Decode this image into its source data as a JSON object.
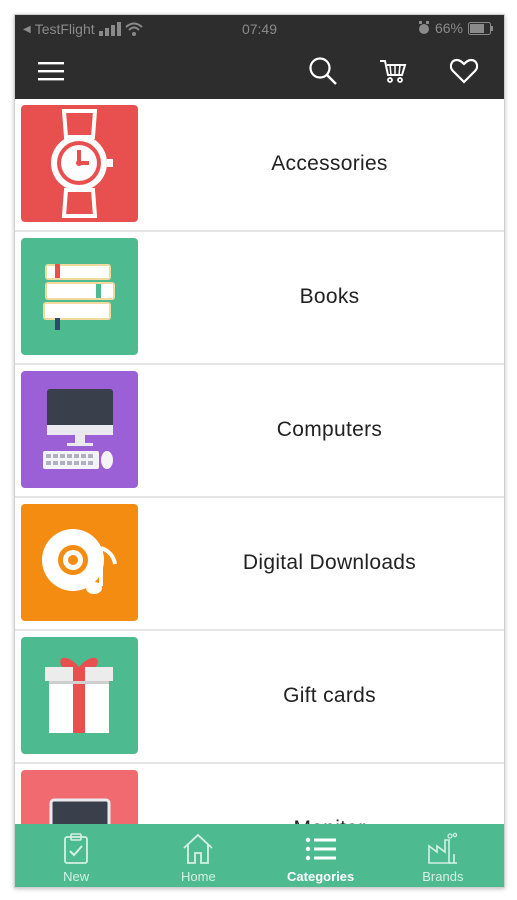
{
  "statusbar": {
    "back_app": "TestFlight",
    "time": "07:49",
    "battery": "66%"
  },
  "toolbar": {
    "icons": [
      "menu-icon",
      "search-icon",
      "cart-icon",
      "heart-icon"
    ]
  },
  "categories": [
    {
      "label": "Accessories",
      "color": "#e8504f",
      "icon": "watch-icon"
    },
    {
      "label": "Books",
      "color": "#4dbb8f",
      "icon": "books-icon"
    },
    {
      "label": "Computers",
      "color": "#9b5fd6",
      "icon": "computer-icon"
    },
    {
      "label": "Digital Downloads",
      "color": "#f58c12",
      "icon": "music-disc-icon"
    },
    {
      "label": "Gift cards",
      "color": "#4dbb8f",
      "icon": "gift-icon"
    },
    {
      "label": "Monitor",
      "color": "#f06a6f",
      "icon": "monitor-icon"
    }
  ],
  "tabbar": {
    "tabs": [
      {
        "label": "New",
        "icon": "clipboard-check-icon",
        "active": false
      },
      {
        "label": "Home",
        "icon": "home-icon",
        "active": false
      },
      {
        "label": "Categories",
        "icon": "list-icon",
        "active": true
      },
      {
        "label": "Brands",
        "icon": "factory-icon",
        "active": false
      }
    ],
    "color": "#4dbb8f"
  }
}
